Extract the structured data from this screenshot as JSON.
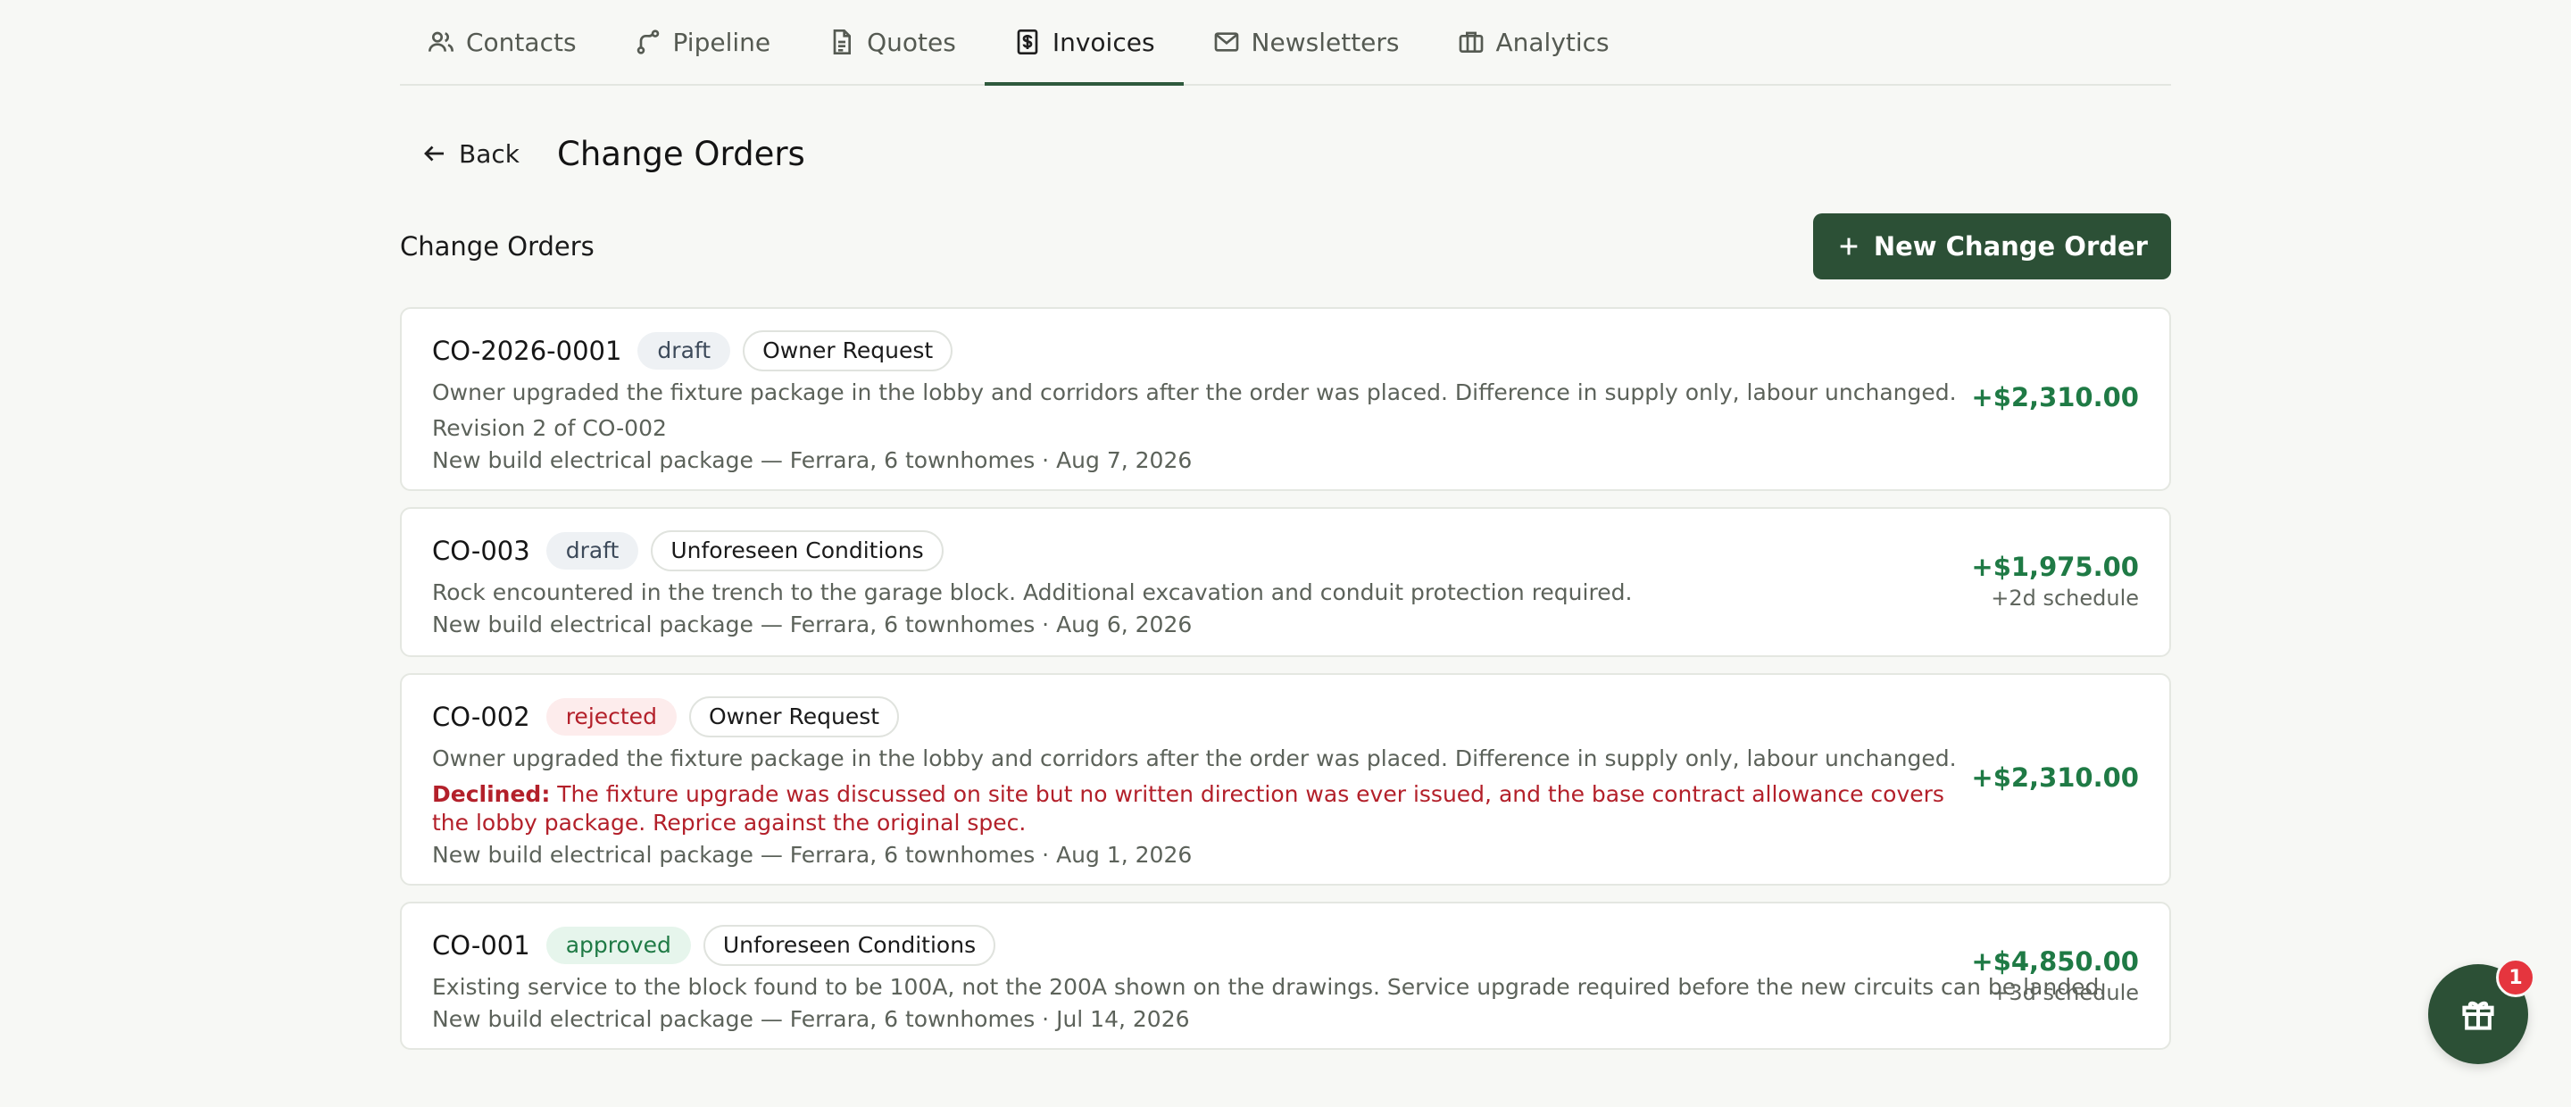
{
  "tabs": [
    {
      "label": "Contacts",
      "icon": "users-icon"
    },
    {
      "label": "Pipeline",
      "icon": "pipeline-icon"
    },
    {
      "label": "Quotes",
      "icon": "document-icon"
    },
    {
      "label": "Invoices",
      "icon": "dollar-receipt-icon",
      "active": true
    },
    {
      "label": "Newsletters",
      "icon": "mail-icon"
    },
    {
      "label": "Analytics",
      "icon": "briefcase-icon"
    }
  ],
  "header": {
    "back_label": "Back",
    "title": "Change Orders"
  },
  "section": {
    "title": "Change Orders",
    "new_button_label": "New Change Order"
  },
  "change_orders": [
    {
      "id": "CO-2026-0001",
      "status": "draft",
      "category": "Owner Request",
      "description": "Owner upgraded the fixture package in the lobby and corridors after the order was placed. Difference in supply only, labour unchanged.",
      "revision": "Revision 2 of CO-002",
      "meta": "New build electrical package — Ferrara, 6 townhomes · Aug 7, 2026",
      "amount": "+$2,310.00"
    },
    {
      "id": "CO-003",
      "status": "draft",
      "category": "Unforeseen Conditions",
      "description": "Rock encountered in the trench to the garage block. Additional excavation and conduit protection required.",
      "meta": "New build electrical package — Ferrara, 6 townhomes · Aug 6, 2026",
      "amount": "+$1,975.00",
      "schedule": "+2d schedule"
    },
    {
      "id": "CO-002",
      "status": "rejected",
      "category": "Owner Request",
      "description": "Owner upgraded the fixture package in the lobby and corridors after the order was placed. Difference in supply only, labour unchanged.",
      "declined_label": "Declined:",
      "declined_reason": "The fixture upgrade was discussed on site but no written direction was ever issued, and the base contract allowance covers the lobby package. Reprice against the original spec.",
      "meta": "New build electrical package — Ferrara, 6 townhomes · Aug 1, 2026",
      "amount": "+$2,310.00"
    },
    {
      "id": "CO-001",
      "status": "approved",
      "category": "Unforeseen Conditions",
      "description": "Existing service to the block found to be 100A, not the 200A shown on the drawings. Service upgrade required before the new circuits can be landed.",
      "meta": "New build electrical package — Ferrara, 6 townhomes · Jul 14, 2026",
      "amount": "+$4,850.00",
      "schedule": "+3d schedule"
    }
  ],
  "fab": {
    "icon": "gift-icon",
    "badge_count": "1"
  },
  "colors": {
    "accent": "#2c5036",
    "positive": "#1f7a45",
    "danger": "#b3202a"
  }
}
